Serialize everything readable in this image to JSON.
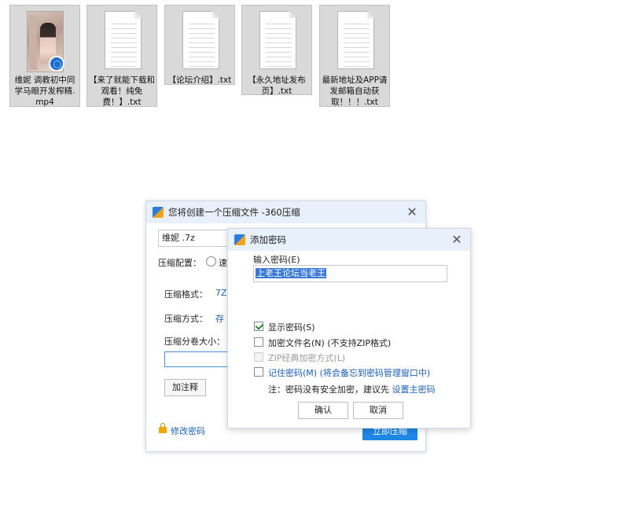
{
  "files": [
    {
      "name": "维妮  调教初中同学马眼开发榨精.mp4",
      "type": "video",
      "badge_icon": "video-play-badge-icon"
    },
    {
      "name": "【来了就能下载和观看！纯免费！】.txt",
      "type": "text"
    },
    {
      "name": "【论坛介绍】.txt",
      "type": "text"
    },
    {
      "name": "【永久地址发布页】.txt",
      "type": "text"
    },
    {
      "name": "最新地址及APP请发邮箱自动获取！！！.txt",
      "type": "text"
    }
  ],
  "main_dialog": {
    "title": "您将创建一个压缩文件 -360压缩",
    "archive_name": "维妮  .7z",
    "config_label": "压缩配置：",
    "config_option_partial": "速",
    "format_label": "压缩格式：",
    "format_value_partial": "7Z",
    "method_label": "压缩方式：",
    "method_value_partial": "存",
    "split_label": "压缩分卷大小：",
    "comment_button": "加注释",
    "modify_password": "修改密码",
    "start_button_partial": "立即压缩"
  },
  "password_dialog": {
    "title": "添加密码",
    "input_label": "输入密码(E)",
    "input_value": "上老王论坛当老王",
    "options": [
      {
        "label": "显示密码(S)",
        "checked": true,
        "disabled": false
      },
      {
        "label": "加密文件名(N) (不支持ZIP格式)",
        "checked": false,
        "disabled": false
      },
      {
        "label": "ZIP经典加密方式(L)",
        "checked": false,
        "disabled": true
      },
      {
        "label": "记住密码(M) (将会备忘到密码管理窗口中)",
        "checked": false,
        "disabled": false
      }
    ],
    "note_prefix": "注：密码没有安全加密，建议先 ",
    "note_link": "设置主密码",
    "ok_button": "确认",
    "cancel_button": "取消"
  },
  "colors": {
    "accent": "#1e88e5",
    "link": "#1c5fb4",
    "titlebar": "#e7f0fb"
  }
}
